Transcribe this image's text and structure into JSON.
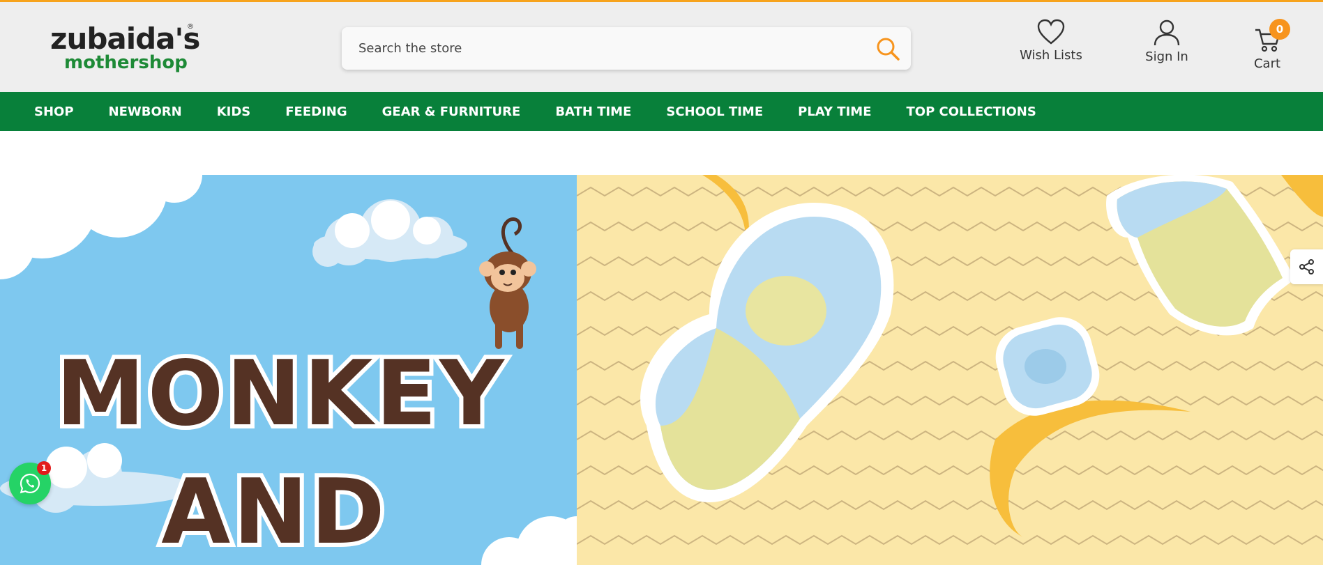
{
  "header": {
    "logo_text": "zubaida's",
    "logo_sub": "mothershop",
    "logo_reg": "®",
    "search_placeholder": "Search the store",
    "wish_lists": "Wish Lists",
    "sign_in": "Sign In",
    "cart": "Cart",
    "cart_count": "0"
  },
  "nav": {
    "items": [
      "SHOP",
      "NEWBORN",
      "KIDS",
      "FEEDING",
      "GEAR & FURNITURE",
      "BATH TIME",
      "SCHOOL TIME",
      "PLAY TIME",
      "TOP COLLECTIONS"
    ]
  },
  "banner": {
    "line1": "MONKEY",
    "line2": "AND"
  },
  "whatsapp": {
    "badge": "1"
  },
  "colors": {
    "accent": "#f7941d",
    "nav_bg": "#08803a",
    "banner_sky": "#7ec8ef",
    "banner_yellow": "#fbe7a8",
    "title_brown": "#553224"
  }
}
